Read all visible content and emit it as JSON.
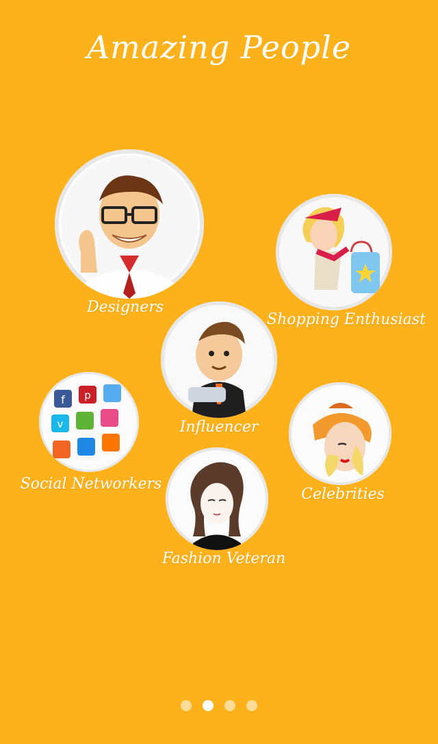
{
  "title": "Amazing People",
  "categories": [
    {
      "label": "Designers",
      "icon": "designer-avatar-icon"
    },
    {
      "label": "Shopping Enthusiast",
      "icon": "shopper-avatar-icon"
    },
    {
      "label": "Influencer",
      "icon": "influencer-avatar-icon"
    },
    {
      "label": "Social Networkers",
      "icon": "social-networks-icon"
    },
    {
      "label": "Celebrities",
      "icon": "celebrity-avatar-icon"
    },
    {
      "label": "Fashion Veteran",
      "icon": "fashion-veteran-avatar-icon"
    }
  ],
  "pager": {
    "count": 4,
    "active_index": 1
  },
  "colors": {
    "background": "#FDB11A",
    "text": "#FFFFFF",
    "dot_inactive": "rgba(255,255,255,0.55)",
    "dot_active": "#FFFFFF"
  }
}
